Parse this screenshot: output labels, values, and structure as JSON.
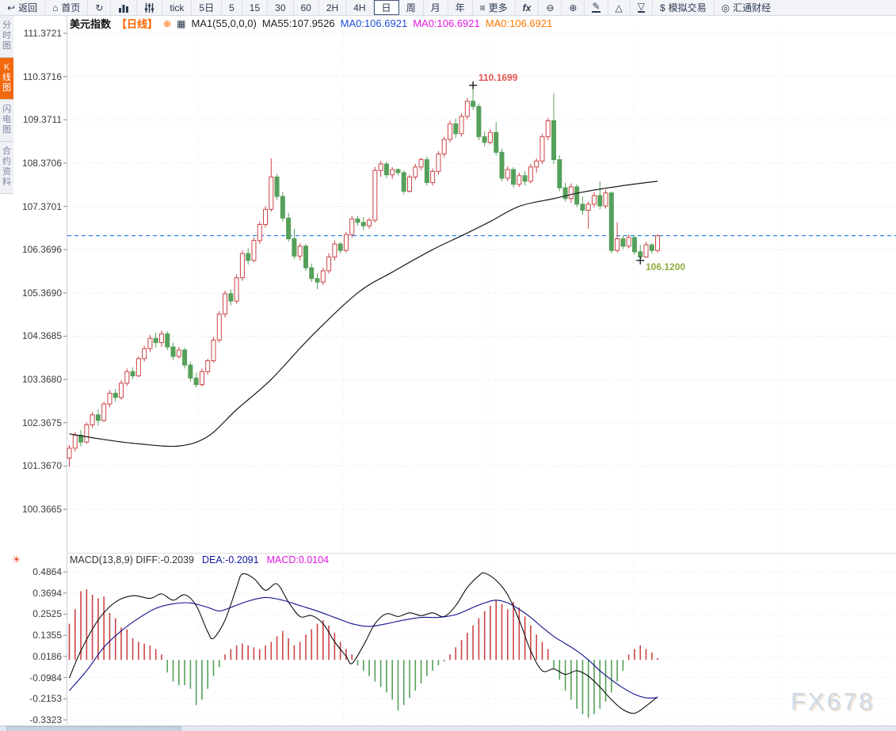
{
  "toolbar": {
    "items": [
      "返回",
      "首页",
      "",
      "",
      "",
      "tick",
      "5日",
      "5",
      "15",
      "30",
      "60",
      "2H",
      "4H",
      "日",
      "周",
      "月",
      "年",
      "更多",
      "fx",
      "",
      "",
      "",
      "",
      "",
      "模拟交易",
      "汇通财经"
    ]
  },
  "icons": {
    "back": "↩",
    "home": "⌂",
    "refresh": "↻",
    "menu": "≡",
    "zoom_out": "⊖",
    "zoom_in": "⊕",
    "pencil": "✎",
    "triangle_up": "△",
    "triangle_down": "▽",
    "dollar": "$",
    "brand_circle": "◎",
    "indicator_settings": "☀",
    "add_indicator": "⊕",
    "mini_chart": "▦"
  },
  "sidebar": {
    "items": [
      "分时图",
      "K线图",
      "闪电图",
      "合约资料"
    ],
    "active": "K线图"
  },
  "title": {
    "symbol": "美元指数",
    "period_tag": "【日线】",
    "ma1": "MA1(55,0,0,0)",
    "ma55": "MA55:107.9526",
    "ma0_blue": "MA0:106.6921",
    "ma0_magenta": "MA0:106.6921",
    "ma0_orange": "MA0:106.6921"
  },
  "macd_header": {
    "title_diff": "MACD(13,8,9) DIFF:-0.2039",
    "dea": "DEA:-0.2091",
    "macd": "MACD:0.0104"
  },
  "annotations": {
    "high": "110.1699",
    "low": "106.1200"
  },
  "watermark": "FX678",
  "colors": {
    "up": "#cc4446",
    "down": "#55a05a",
    "ma55": "#1a1a1a",
    "last_price_dash": "#1a79e8",
    "diff": "#111111",
    "dea": "#10108c",
    "accent_orange": "#f2680c"
  },
  "chart_data": [
    {
      "type": "candlestick",
      "title": "美元指数 日线",
      "y_axis_labels": [
        "111.3721",
        "110.3716",
        "109.3711",
        "108.3706",
        "107.3701",
        "106.3696",
        "105.3690",
        "104.3685",
        "103.3680",
        "102.3675",
        "101.3670",
        "100.3665"
      ],
      "ylim": [
        100.3665,
        111.3721
      ],
      "last_price_line": 106.6921,
      "high_marker": {
        "index": 70,
        "price": 110.1699
      },
      "low_marker": {
        "index": 99,
        "price": 106.12
      },
      "ohlc": [
        [
          101.55,
          101.85,
          101.35,
          101.78
        ],
        [
          101.78,
          102.15,
          101.7,
          102.08
        ],
        [
          102.08,
          102.2,
          101.82,
          101.92
        ],
        [
          101.92,
          102.38,
          101.88,
          102.32
        ],
        [
          102.32,
          102.62,
          102.25,
          102.55
        ],
        [
          102.55,
          102.68,
          102.3,
          102.42
        ],
        [
          102.42,
          102.85,
          102.38,
          102.8
        ],
        [
          102.8,
          103.12,
          102.72,
          103.05
        ],
        [
          103.05,
          103.15,
          102.85,
          102.95
        ],
        [
          102.95,
          103.35,
          102.9,
          103.28
        ],
        [
          103.28,
          103.62,
          103.22,
          103.55
        ],
        [
          103.55,
          103.65,
          103.38,
          103.45
        ],
        [
          103.45,
          103.9,
          103.42,
          103.85
        ],
        [
          103.85,
          104.15,
          103.78,
          104.08
        ],
        [
          104.08,
          104.4,
          104.0,
          104.32
        ],
        [
          104.32,
          104.45,
          104.1,
          104.22
        ],
        [
          104.22,
          104.5,
          104.12,
          104.42
        ],
        [
          104.42,
          104.48,
          104.05,
          104.12
        ],
        [
          104.12,
          104.22,
          103.82,
          103.9
        ],
        [
          103.9,
          104.12,
          103.85,
          104.05
        ],
        [
          104.05,
          104.1,
          103.62,
          103.7
        ],
        [
          103.7,
          103.78,
          103.32,
          103.4
        ],
        [
          103.4,
          103.52,
          103.18,
          103.25
        ],
        [
          103.25,
          103.62,
          103.2,
          103.55
        ],
        [
          103.55,
          103.85,
          103.48,
          103.8
        ],
        [
          103.8,
          104.35,
          103.75,
          104.28
        ],
        [
          104.28,
          104.95,
          104.22,
          104.88
        ],
        [
          104.88,
          105.42,
          104.8,
          105.35
        ],
        [
          105.35,
          105.45,
          105.08,
          105.18
        ],
        [
          105.18,
          105.8,
          105.12,
          105.72
        ],
        [
          105.72,
          106.35,
          105.65,
          106.28
        ],
        [
          106.28,
          106.4,
          106.02,
          106.12
        ],
        [
          106.12,
          106.65,
          106.08,
          106.58
        ],
        [
          106.58,
          107.02,
          106.5,
          106.95
        ],
        [
          106.95,
          107.38,
          106.88,
          107.3
        ],
        [
          107.3,
          108.48,
          107.25,
          108.05
        ],
        [
          108.05,
          108.12,
          107.52,
          107.6
        ],
        [
          107.6,
          107.7,
          107.02,
          107.1
        ],
        [
          107.1,
          107.22,
          106.55,
          106.62
        ],
        [
          106.62,
          106.85,
          106.15,
          106.22
        ],
        [
          106.22,
          106.52,
          106.12,
          106.45
        ],
        [
          106.45,
          106.5,
          105.88,
          105.95
        ],
        [
          105.95,
          106.05,
          105.62,
          105.7
        ],
        [
          105.7,
          105.82,
          105.45,
          105.62
        ],
        [
          105.62,
          105.95,
          105.55,
          105.88
        ],
        [
          105.88,
          106.28,
          105.82,
          106.2
        ],
        [
          106.2,
          106.58,
          106.12,
          106.5
        ],
        [
          106.5,
          106.55,
          106.28,
          106.35
        ],
        [
          106.35,
          106.78,
          106.3,
          106.72
        ],
        [
          106.72,
          107.15,
          106.65,
          107.08
        ],
        [
          107.08,
          107.15,
          106.92,
          107.0
        ],
        [
          107.0,
          107.12,
          106.82,
          106.92
        ],
        [
          106.92,
          107.1,
          106.85,
          107.05
        ],
        [
          107.05,
          108.28,
          107.0,
          108.2
        ],
        [
          108.2,
          108.42,
          108.05,
          108.35
        ],
        [
          108.35,
          108.4,
          108.02,
          108.1
        ],
        [
          108.1,
          108.28,
          108.0,
          108.22
        ],
        [
          108.22,
          108.25,
          108.08,
          108.15
        ],
        [
          108.15,
          108.2,
          107.65,
          107.72
        ],
        [
          107.72,
          108.1,
          107.68,
          108.05
        ],
        [
          108.05,
          108.35,
          107.98,
          108.28
        ],
        [
          108.28,
          108.5,
          108.2,
          108.45
        ],
        [
          108.45,
          108.52,
          107.85,
          107.92
        ],
        [
          107.92,
          108.25,
          107.85,
          108.18
        ],
        [
          108.18,
          108.65,
          108.1,
          108.58
        ],
        [
          108.58,
          108.98,
          108.5,
          108.92
        ],
        [
          108.92,
          109.35,
          108.85,
          109.28
        ],
        [
          109.28,
          109.4,
          108.95,
          109.05
        ],
        [
          109.05,
          109.52,
          108.98,
          109.45
        ],
        [
          109.45,
          109.88,
          109.38,
          109.8
        ],
        [
          109.8,
          110.17,
          109.6,
          109.68
        ],
        [
          109.68,
          109.75,
          108.9,
          108.98
        ],
        [
          108.98,
          109.1,
          108.75,
          108.85
        ],
        [
          108.85,
          109.15,
          108.8,
          109.08
        ],
        [
          109.08,
          109.32,
          108.55,
          108.62
        ],
        [
          108.62,
          108.7,
          107.95,
          108.02
        ],
        [
          108.02,
          108.3,
          107.95,
          108.22
        ],
        [
          108.22,
          108.28,
          107.8,
          107.88
        ],
        [
          107.88,
          108.15,
          107.82,
          108.08
        ],
        [
          108.08,
          108.18,
          107.85,
          107.95
        ],
        [
          107.95,
          108.35,
          107.9,
          108.28
        ],
        [
          108.28,
          108.48,
          108.15,
          108.42
        ],
        [
          108.42,
          109.05,
          108.35,
          108.98
        ],
        [
          108.98,
          109.42,
          108.9,
          109.35
        ],
        [
          109.35,
          109.98,
          108.35,
          108.45
        ],
        [
          108.45,
          108.55,
          107.72,
          107.8
        ],
        [
          107.8,
          107.92,
          107.48,
          107.55
        ],
        [
          107.55,
          107.9,
          107.45,
          107.82
        ],
        [
          107.82,
          107.88,
          107.35,
          107.42
        ],
        [
          107.42,
          107.6,
          107.18,
          107.28
        ],
        [
          107.28,
          107.48,
          106.85,
          107.42
        ],
        [
          107.42,
          107.7,
          107.35,
          107.62
        ],
        [
          107.62,
          107.95,
          107.3,
          107.38
        ],
        [
          107.38,
          107.75,
          107.32,
          107.68
        ],
        [
          107.68,
          107.72,
          106.28,
          106.35
        ],
        [
          106.35,
          107.0,
          106.3,
          106.62
        ],
        [
          106.62,
          106.7,
          106.38,
          106.45
        ],
        [
          106.45,
          106.72,
          106.4,
          106.65
        ],
        [
          106.65,
          106.68,
          106.25,
          106.32
        ],
        [
          106.32,
          106.48,
          106.12,
          106.2
        ],
        [
          106.2,
          106.55,
          106.18,
          106.48
        ],
        [
          106.48,
          106.52,
          106.28,
          106.35
        ],
        [
          106.35,
          106.72,
          106.3,
          106.69
        ]
      ],
      "ma55_anchors": [
        [
          0,
          102.11
        ],
        [
          6,
          101.98
        ],
        [
          12,
          101.88
        ],
        [
          19,
          101.83
        ],
        [
          24,
          102.05
        ],
        [
          29,
          102.67
        ],
        [
          35,
          103.37
        ],
        [
          42,
          104.37
        ],
        [
          50,
          105.37
        ],
        [
          56,
          105.85
        ],
        [
          63,
          106.37
        ],
        [
          68,
          106.69
        ],
        [
          73,
          107.02
        ],
        [
          78,
          107.37
        ],
        [
          84,
          107.55
        ],
        [
          89,
          107.7
        ],
        [
          96,
          107.85
        ],
        [
          102,
          107.95
        ]
      ]
    },
    {
      "type": "macd",
      "y_axis_labels": [
        "0.4864",
        "0.3694",
        "0.2525",
        "0.1355",
        "0.0186",
        "-0.0984",
        "-0.2153",
        "-0.3323"
      ],
      "ylim": [
        -0.3323,
        0.4864
      ],
      "histogram": [
        0.2,
        0.28,
        0.38,
        0.39,
        0.36,
        0.34,
        0.35,
        0.26,
        0.23,
        0.18,
        0.17,
        0.12,
        0.1,
        0.09,
        0.08,
        0.06,
        0.03,
        -0.07,
        -0.12,
        -0.14,
        -0.14,
        -0.16,
        -0.25,
        -0.22,
        -0.16,
        -0.09,
        -0.04,
        0.03,
        0.06,
        0.08,
        0.09,
        0.08,
        0.07,
        0.06,
        0.08,
        0.1,
        0.13,
        0.16,
        0.12,
        0.08,
        0.1,
        0.14,
        0.17,
        0.2,
        0.22,
        0.19,
        0.15,
        0.1,
        0.06,
        0.03,
        -0.03,
        -0.06,
        -0.09,
        -0.12,
        -0.15,
        -0.18,
        -0.22,
        -0.28,
        -0.25,
        -0.21,
        -0.17,
        -0.13,
        -0.09,
        -0.06,
        -0.03,
        -0.01,
        0.03,
        0.07,
        0.11,
        0.15,
        0.19,
        0.23,
        0.27,
        0.3,
        0.33,
        0.31,
        0.28,
        0.32,
        0.29,
        0.24,
        0.19,
        0.14,
        0.1,
        0.06,
        -0.05,
        -0.11,
        -0.17,
        -0.22,
        -0.27,
        -0.3,
        -0.32,
        -0.3,
        -0.27,
        -0.23,
        -0.18,
        -0.12,
        -0.06,
        0.03,
        0.06,
        0.08,
        0.06,
        0.04,
        0.0104
      ],
      "diff_anchors": [
        [
          0,
          -0.1
        ],
        [
          2,
          0.05
        ],
        [
          5,
          0.22
        ],
        [
          8,
          0.32
        ],
        [
          11,
          0.355
        ],
        [
          14,
          0.34
        ],
        [
          16,
          0.365
        ],
        [
          18,
          0.33
        ],
        [
          20,
          0.36
        ],
        [
          22,
          0.3
        ],
        [
          24,
          0.155
        ],
        [
          25,
          0.12
        ],
        [
          27,
          0.22
        ],
        [
          29,
          0.4
        ],
        [
          30,
          0.475
        ],
        [
          32,
          0.45
        ],
        [
          34,
          0.385
        ],
        [
          36,
          0.42
        ],
        [
          38,
          0.32
        ],
        [
          40,
          0.24
        ],
        [
          42,
          0.245
        ],
        [
          44,
          0.2
        ],
        [
          46,
          0.1
        ],
        [
          48,
          0.02
        ],
        [
          49,
          -0.02
        ],
        [
          51,
          0.08
        ],
        [
          53,
          0.2
        ],
        [
          55,
          0.255
        ],
        [
          57,
          0.24
        ],
        [
          59,
          0.26
        ],
        [
          61,
          0.245
        ],
        [
          63,
          0.26
        ],
        [
          65,
          0.24
        ],
        [
          67,
          0.3
        ],
        [
          69,
          0.4
        ],
        [
          71,
          0.465
        ],
        [
          72,
          0.48
        ],
        [
          74,
          0.44
        ],
        [
          76,
          0.36
        ],
        [
          78,
          0.22
        ],
        [
          80,
          0.05
        ],
        [
          82,
          -0.06
        ],
        [
          84,
          -0.05
        ],
        [
          86,
          -0.08
        ],
        [
          88,
          -0.06
        ],
        [
          90,
          -0.09
        ],
        [
          92,
          -0.15
        ],
        [
          94,
          -0.22
        ],
        [
          96,
          -0.275
        ],
        [
          98,
          -0.295
        ],
        [
          100,
          -0.255
        ],
        [
          102,
          -0.204
        ]
      ],
      "dea_anchors": [
        [
          0,
          -0.17
        ],
        [
          3,
          -0.06
        ],
        [
          6,
          0.07
        ],
        [
          9,
          0.16
        ],
        [
          12,
          0.23
        ],
        [
          15,
          0.285
        ],
        [
          18,
          0.31
        ],
        [
          21,
          0.315
        ],
        [
          24,
          0.29
        ],
        [
          26,
          0.27
        ],
        [
          28,
          0.29
        ],
        [
          31,
          0.325
        ],
        [
          34,
          0.345
        ],
        [
          37,
          0.33
        ],
        [
          40,
          0.3
        ],
        [
          43,
          0.27
        ],
        [
          46,
          0.235
        ],
        [
          49,
          0.2
        ],
        [
          52,
          0.185
        ],
        [
          55,
          0.2
        ],
        [
          58,
          0.22
        ],
        [
          61,
          0.235
        ],
        [
          64,
          0.235
        ],
        [
          67,
          0.25
        ],
        [
          70,
          0.29
        ],
        [
          72,
          0.315
        ],
        [
          74,
          0.33
        ],
        [
          76,
          0.315
        ],
        [
          78,
          0.28
        ],
        [
          80,
          0.235
        ],
        [
          82,
          0.18
        ],
        [
          84,
          0.13
        ],
        [
          86,
          0.09
        ],
        [
          88,
          0.05
        ],
        [
          90,
          0.0
        ],
        [
          92,
          -0.06
        ],
        [
          94,
          -0.11
        ],
        [
          96,
          -0.155
        ],
        [
          98,
          -0.19
        ],
        [
          100,
          -0.21
        ],
        [
          102,
          -0.209
        ]
      ]
    }
  ]
}
